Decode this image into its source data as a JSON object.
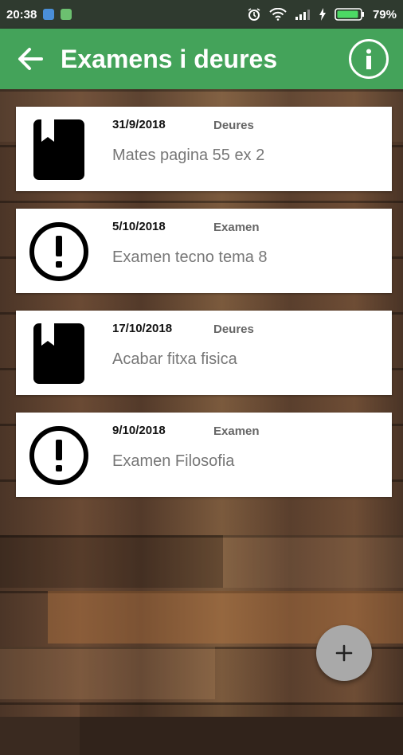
{
  "status_bar": {
    "time": "20:38",
    "battery": "79%",
    "icons": [
      "shield-notification-icon",
      "app-notification-icon",
      "alarm-icon",
      "wifi-icon",
      "signal-icon",
      "charging-icon",
      "battery-icon"
    ]
  },
  "app_bar": {
    "title": "Examens i deures",
    "back_icon": "arrow-back-icon",
    "info_icon": "info-icon",
    "color": "#44a35a"
  },
  "items": [
    {
      "date": "31/9/2018",
      "type": "Deures",
      "text": "Mates pagina 55 ex 2",
      "icon": "bookmark-book-icon"
    },
    {
      "date": "5/10/2018",
      "type": "Examen",
      "text": "Examen tecno tema 8",
      "icon": "alert-circle-icon"
    },
    {
      "date": "17/10/2018",
      "type": "Deures",
      "text": "Acabar fitxa fisica",
      "icon": "bookmark-book-icon"
    },
    {
      "date": "9/10/2018",
      "type": "Examen",
      "text": "Examen Filosofia",
      "icon": "alert-circle-icon"
    }
  ],
  "fab": {
    "icon": "plus-icon"
  }
}
